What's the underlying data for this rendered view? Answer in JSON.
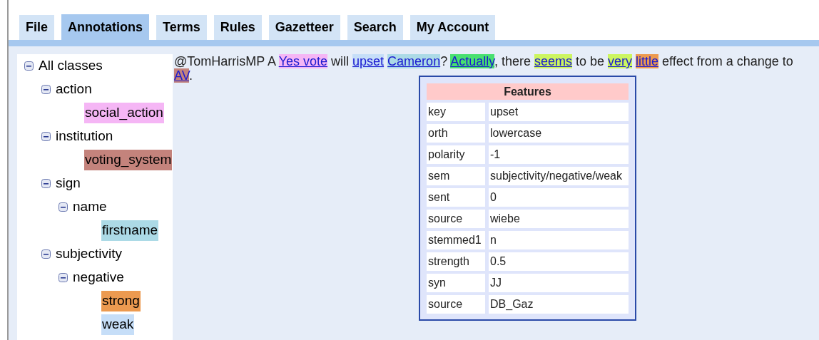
{
  "tabs": [
    {
      "label": "File",
      "selected": false
    },
    {
      "label": "Annotations",
      "selected": true
    },
    {
      "label": "Terms",
      "selected": false
    },
    {
      "label": "Rules",
      "selected": false
    },
    {
      "label": "Gazetteer",
      "selected": false
    },
    {
      "label": "Search",
      "selected": false
    },
    {
      "label": "My Account",
      "selected": false
    }
  ],
  "class_tree": {
    "label": "All classes",
    "expanded": true,
    "children": [
      {
        "label": "action",
        "expanded": true,
        "children": [
          {
            "label": "social_action",
            "color": "#f5b6f5"
          }
        ]
      },
      {
        "label": "institution",
        "expanded": true,
        "children": [
          {
            "label": "voting_system",
            "color": "#c4837c"
          }
        ]
      },
      {
        "label": "sign",
        "expanded": true,
        "children": [
          {
            "label": "name",
            "expanded": true,
            "children": [
              {
                "label": "firstname",
                "color": "#acdae6"
              }
            ]
          }
        ]
      },
      {
        "label": "subjectivity",
        "expanded": true,
        "children": [
          {
            "label": "negative",
            "expanded": true,
            "children": [
              {
                "label": "strong",
                "color": "#ec9a50"
              },
              {
                "label": "weak",
                "color": "#c6def8"
              }
            ]
          }
        ]
      }
    ]
  },
  "document_text": [
    {
      "kind": "plain",
      "text": "@TomHarrisMP A "
    },
    {
      "kind": "annotation",
      "text": "Yes vote",
      "color": "#f5b6f5"
    },
    {
      "kind": "plain",
      "text": " will "
    },
    {
      "kind": "annotation",
      "text": "upset",
      "color": "#c6def8"
    },
    {
      "kind": "space"
    },
    {
      "kind": "annotation",
      "text": "Cameron",
      "color": "#acdae6"
    },
    {
      "kind": "plain",
      "text": "? "
    },
    {
      "kind": "annotation",
      "text": "Actually",
      "color": "#48e070"
    },
    {
      "kind": "plain",
      "text": ", there "
    },
    {
      "kind": "annotation",
      "text": "seems",
      "color": "#ccf560"
    },
    {
      "kind": "plain",
      "text": " to be "
    },
    {
      "kind": "annotation",
      "text": "very",
      "color": "#ccf560"
    },
    {
      "kind": "space"
    },
    {
      "kind": "annotation",
      "text": "little",
      "color": "#ec9a50"
    },
    {
      "kind": "plain",
      "text": " effect from a change to "
    },
    {
      "kind": "annotation",
      "text": "AV",
      "color": "#c4837c"
    },
    {
      "kind": "plain",
      "text": "."
    }
  ],
  "features_popup": {
    "title": "Features",
    "rows": [
      {
        "key": "key",
        "value": "upset"
      },
      {
        "key": "orth",
        "value": "lowercase"
      },
      {
        "key": "polarity",
        "value": "-1"
      },
      {
        "key": "sem",
        "value": "subjectivity/negative/weak"
      },
      {
        "key": "sent",
        "value": "0"
      },
      {
        "key": "source",
        "value": "wiebe"
      },
      {
        "key": "stemmed1",
        "value": "n"
      },
      {
        "key": "strength",
        "value": "0.5"
      },
      {
        "key": "syn",
        "value": "JJ"
      },
      {
        "key": "source",
        "value": "DB_Gaz"
      }
    ]
  }
}
